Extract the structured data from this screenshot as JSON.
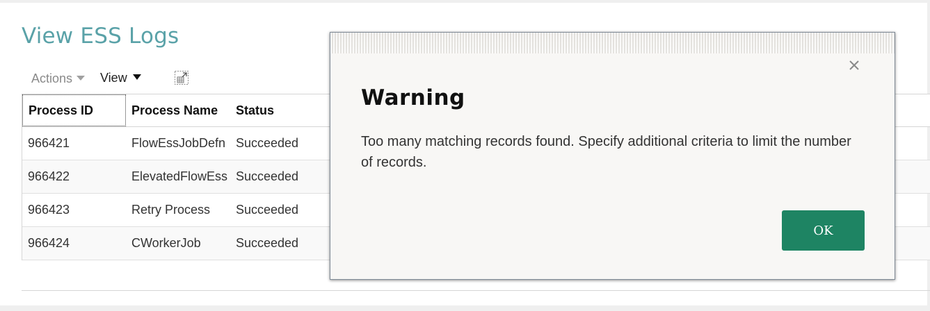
{
  "page": {
    "title": "View ESS Logs"
  },
  "toolbar": {
    "actions_label": "Actions",
    "view_label": "View",
    "detach_icon": "detach-icon"
  },
  "table": {
    "columns": [
      "Process ID",
      "Process Name",
      "Status"
    ],
    "rows": [
      {
        "process_id": "966421",
        "process_name": "FlowEssJobDefn",
        "status": "Succeeded"
      },
      {
        "process_id": "966422",
        "process_name": "ElevatedFlowEss",
        "status": "Succeeded"
      },
      {
        "process_id": "966423",
        "process_name": "Retry Process",
        "status": "Succeeded"
      },
      {
        "process_id": "966424",
        "process_name": "CWorkerJob",
        "status": "Succeeded"
      }
    ]
  },
  "dialog": {
    "title": "Warning",
    "message": "Too many matching records found. Specify additional criteria to limit the number of records.",
    "ok_label": "OK",
    "close_icon": "close-icon"
  },
  "colors": {
    "title_teal": "#5aa2a8",
    "ok_green": "#1e8463"
  }
}
